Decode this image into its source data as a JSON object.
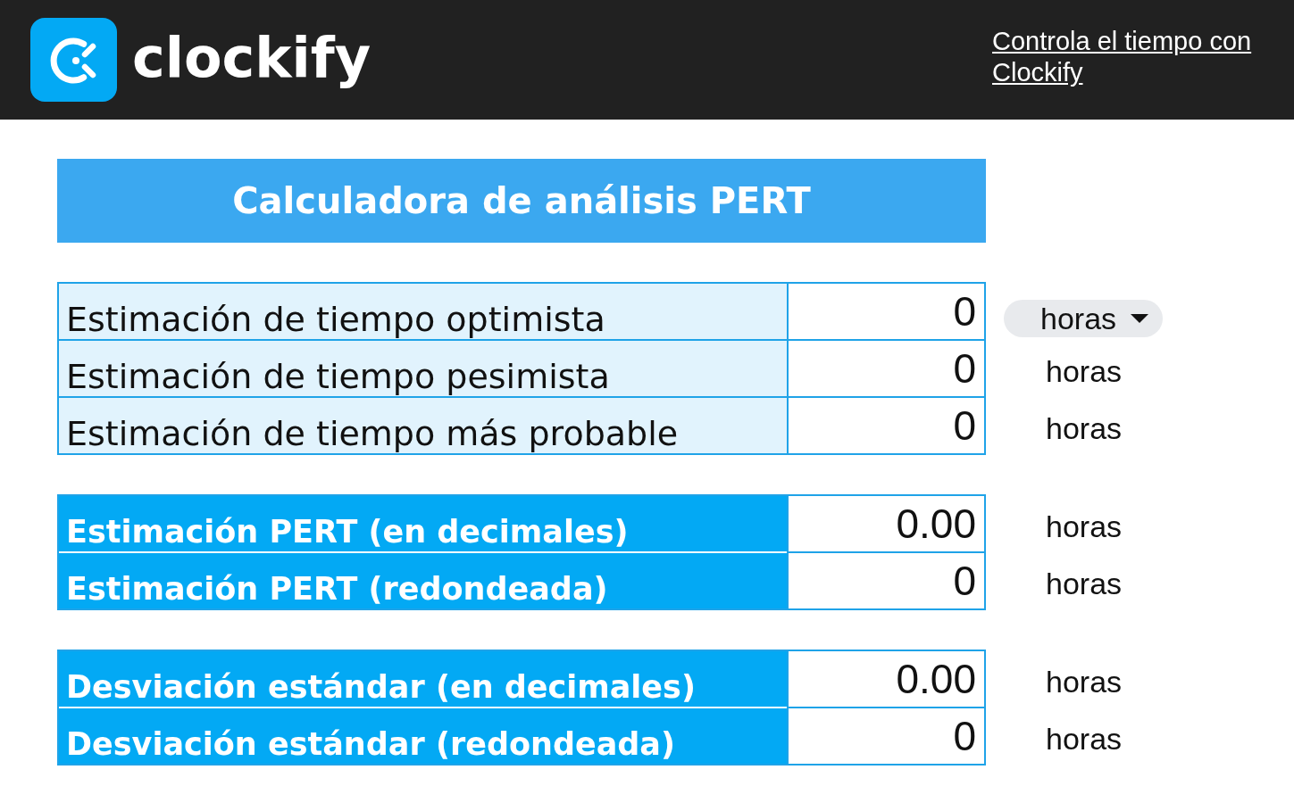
{
  "header": {
    "logo_text": "clockify",
    "link": "Controla el tiempo con Clockify"
  },
  "title": "Calculadora de análisis PERT",
  "sections": [
    {
      "kind": "input",
      "rows": [
        {
          "label": "Estimación de tiempo optimista",
          "value": "0",
          "unit": {
            "kind": "dropdown",
            "text": "horas"
          }
        },
        {
          "label": "Estimación de tiempo pesimista",
          "value": "0",
          "unit": {
            "kind": "text",
            "text": "horas"
          }
        },
        {
          "label": "Estimación de tiempo más probable",
          "value": "0",
          "unit": {
            "kind": "text",
            "text": "horas"
          }
        }
      ]
    },
    {
      "kind": "result",
      "rows": [
        {
          "label": "Estimación PERT (en decimales)",
          "value": "0.00",
          "unit": {
            "kind": "text",
            "text": "horas"
          }
        },
        {
          "label": "Estimación PERT (redondeada)",
          "value": "0",
          "unit": {
            "kind": "text",
            "text": "horas"
          }
        }
      ]
    },
    {
      "kind": "result",
      "rows": [
        {
          "label": "Desviación estándar (en decimales)",
          "value": "0.00",
          "unit": {
            "kind": "text",
            "text": "horas"
          }
        },
        {
          "label": "Desviación estándar (redondeada)",
          "value": "0",
          "unit": {
            "kind": "text",
            "text": "horas"
          }
        }
      ]
    }
  ]
}
